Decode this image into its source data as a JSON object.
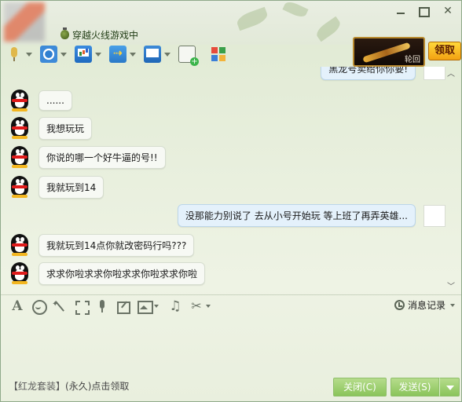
{
  "window": {
    "game_status": "穿越火线游戏中",
    "min_icon": "minimize-icon",
    "max_icon": "maximize-icon",
    "close_glyph": "✕"
  },
  "toolbar": {
    "items": [
      {
        "name": "voice-call",
        "icon": "microphone-icon"
      },
      {
        "name": "video-call",
        "icon": "camera-icon"
      },
      {
        "name": "remote-screen",
        "icon": "screen-share-icon"
      },
      {
        "name": "send-file",
        "icon": "folder-transfer-icon"
      },
      {
        "name": "remote-assist",
        "icon": "remote-desktop-icon"
      },
      {
        "name": "create-group",
        "icon": "chat-add-icon"
      },
      {
        "name": "apps",
        "icon": "apps-grid-icon"
      }
    ]
  },
  "promo": {
    "weapon_label": "轮回",
    "claim_label": "领取",
    "text_tag": "【红龙套装】",
    "text_duration": "(永久)",
    "text_action": "点击领取"
  },
  "chat": {
    "top_partial": "黑龙号卖给你你要!",
    "messages": [
      {
        "dir": "in",
        "text": "......"
      },
      {
        "dir": "in",
        "text": "我想玩玩"
      },
      {
        "dir": "in",
        "text": "你说的哪一个好牛逼的号!!"
      },
      {
        "dir": "in",
        "text": "我就玩到14"
      },
      {
        "dir": "out",
        "text": "没那能力别说了  去从小号开始玩  等上班了再弄英雄..."
      },
      {
        "dir": "in",
        "text": "我就玩到14点你就改密码行吗???"
      },
      {
        "dir": "in",
        "text": "求求你啦求求你啦求求你啦求求你啦"
      }
    ]
  },
  "input_toolbar": {
    "font_glyph": "A",
    "music_glyph": "♫",
    "scissors_glyph": "✂",
    "history_label": "消息记录"
  },
  "buttons": {
    "close_label": "关闭(C)",
    "send_label": "发送(S)"
  },
  "colors": {
    "send_button": "#8ac45a",
    "claim_button": "#f3a112",
    "outgoing_bubble": "#e4f1fb"
  }
}
